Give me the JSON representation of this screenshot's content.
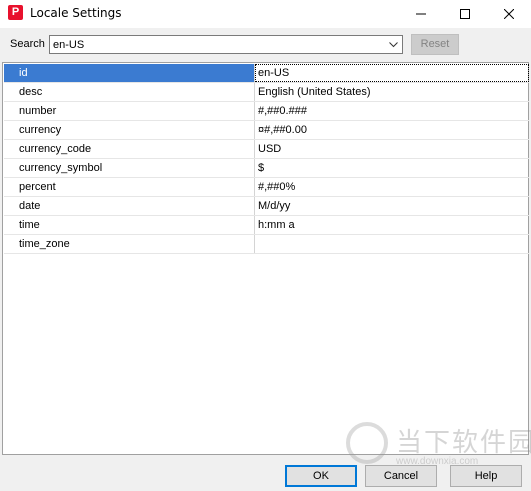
{
  "window": {
    "title": "Locale Settings",
    "icon_letter": "P",
    "icon_color": "#e8112d"
  },
  "search": {
    "label": "Search",
    "value": "en-US",
    "reset_label": "Reset"
  },
  "table": {
    "selected_row": 0,
    "rows": [
      {
        "key": "id",
        "value": "en-US"
      },
      {
        "key": "desc",
        "value": "English (United States)"
      },
      {
        "key": "number",
        "value": "#,##0.###"
      },
      {
        "key": "currency",
        "value": "¤#,##0.00"
      },
      {
        "key": "currency_code",
        "value": "USD"
      },
      {
        "key": "currency_symbol",
        "value": "$"
      },
      {
        "key": "percent",
        "value": "#,##0%"
      },
      {
        "key": "date",
        "value": "M/d/yy"
      },
      {
        "key": "time",
        "value": "h:mm a"
      },
      {
        "key": "time_zone",
        "value": ""
      }
    ]
  },
  "buttons": {
    "ok": "OK",
    "cancel": "Cancel",
    "help": "Help"
  },
  "watermark": {
    "text": "当下软件园",
    "url": "www.downxia.com"
  },
  "colors": {
    "selection": "#3b7bd1",
    "focus_border": "#0078d7"
  }
}
